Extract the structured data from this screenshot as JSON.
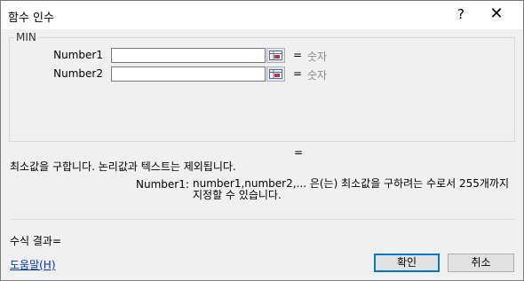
{
  "dialog": {
    "title": "함수 인수",
    "help_glyph": "?",
    "close_glyph": "✕"
  },
  "function": {
    "name": "MIN",
    "args": [
      {
        "label": "Number1",
        "value": "",
        "eq": "=",
        "result": "숫자"
      },
      {
        "label": "Number2",
        "value": "",
        "eq": "=",
        "result": "숫자"
      }
    ],
    "overall_eq": "="
  },
  "description": "최소값을 구합니다. 논리값과 텍스트는 제외됩니다.",
  "arg_help": {
    "name": "Number1:",
    "text": "number1,number2,... 은(는) 최소값을 구하려는 수로서 255개까지 지정할 수 있습니다."
  },
  "formula_result_label": "수식 결과=",
  "help_link": "도움말(H)",
  "buttons": {
    "ok": "확인",
    "cancel": "취소"
  },
  "icons": {
    "ref": "range-select-icon",
    "help": "question-mark-icon",
    "close": "close-icon"
  }
}
